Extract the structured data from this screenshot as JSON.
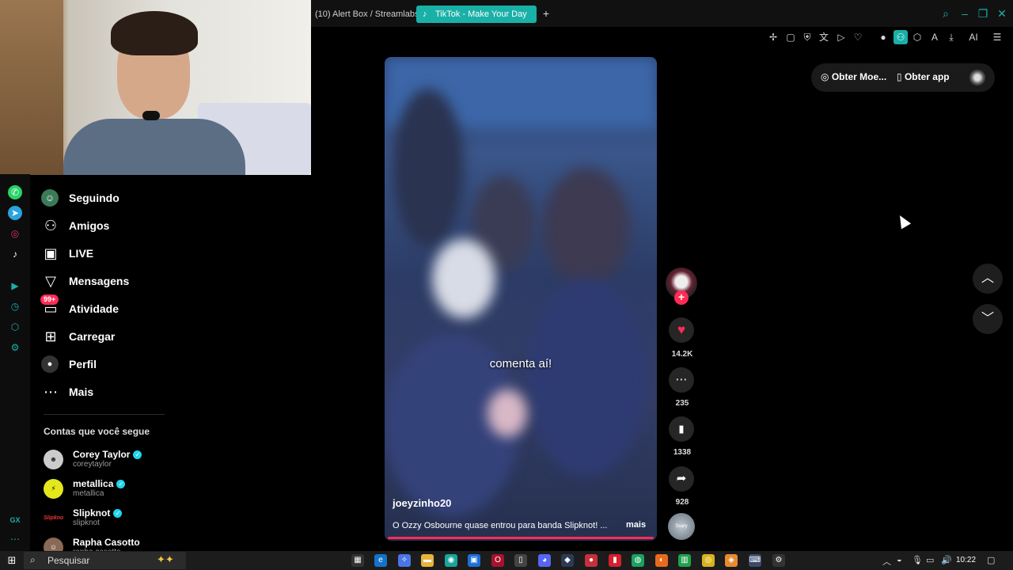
{
  "browser": {
    "tabs": [
      {
        "label": "(10) Alert Box / Streamlabs",
        "active": false
      },
      {
        "label": "TikTok - Make Your Day",
        "active": true
      }
    ],
    "new_tab": "+",
    "accent": "#19b0a7",
    "toolbar_ai": "AI"
  },
  "sidebar": {
    "nav": [
      {
        "label": "Seguindo",
        "icon": "following-icon"
      },
      {
        "label": "Amigos",
        "icon": "friends-icon"
      },
      {
        "label": "LIVE",
        "icon": "live-icon"
      },
      {
        "label": "Mensagens",
        "icon": "messages-icon"
      },
      {
        "label": "Atividade",
        "icon": "activity-icon",
        "badge": "99+"
      },
      {
        "label": "Carregar",
        "icon": "upload-icon"
      },
      {
        "label": "Perfil",
        "icon": "profile-icon"
      },
      {
        "label": "Mais",
        "icon": "more-icon"
      }
    ],
    "following_title": "Contas que você segue",
    "accounts": [
      {
        "name": "Corey Taylor",
        "handle": "coreytaylor",
        "verified": true
      },
      {
        "name": "metallica",
        "handle": "metallica",
        "verified": true
      },
      {
        "name": "Slipknot",
        "handle": "slipknot",
        "verified": true,
        "logo": "Slipknot"
      },
      {
        "name": "Rapha Casotto",
        "handle": "rapha.casotto",
        "verified": false
      }
    ]
  },
  "video": {
    "caption_overlay": "comenta aí!",
    "username": "joeyzinho20",
    "description": "O Ozzy Osbourne quase entrou para banda Slipknot! ...",
    "more": "mais"
  },
  "actions": {
    "likes": "14.2K",
    "comments": "235",
    "saves": "1338",
    "shares": "928",
    "music_label": "Scary",
    "like_color": "#fe2c55"
  },
  "top_actions": {
    "coins": "Obter Moe...",
    "app": "Obter app"
  },
  "taskbar": {
    "search_placeholder": "Pesquisar",
    "time": "10:22"
  }
}
